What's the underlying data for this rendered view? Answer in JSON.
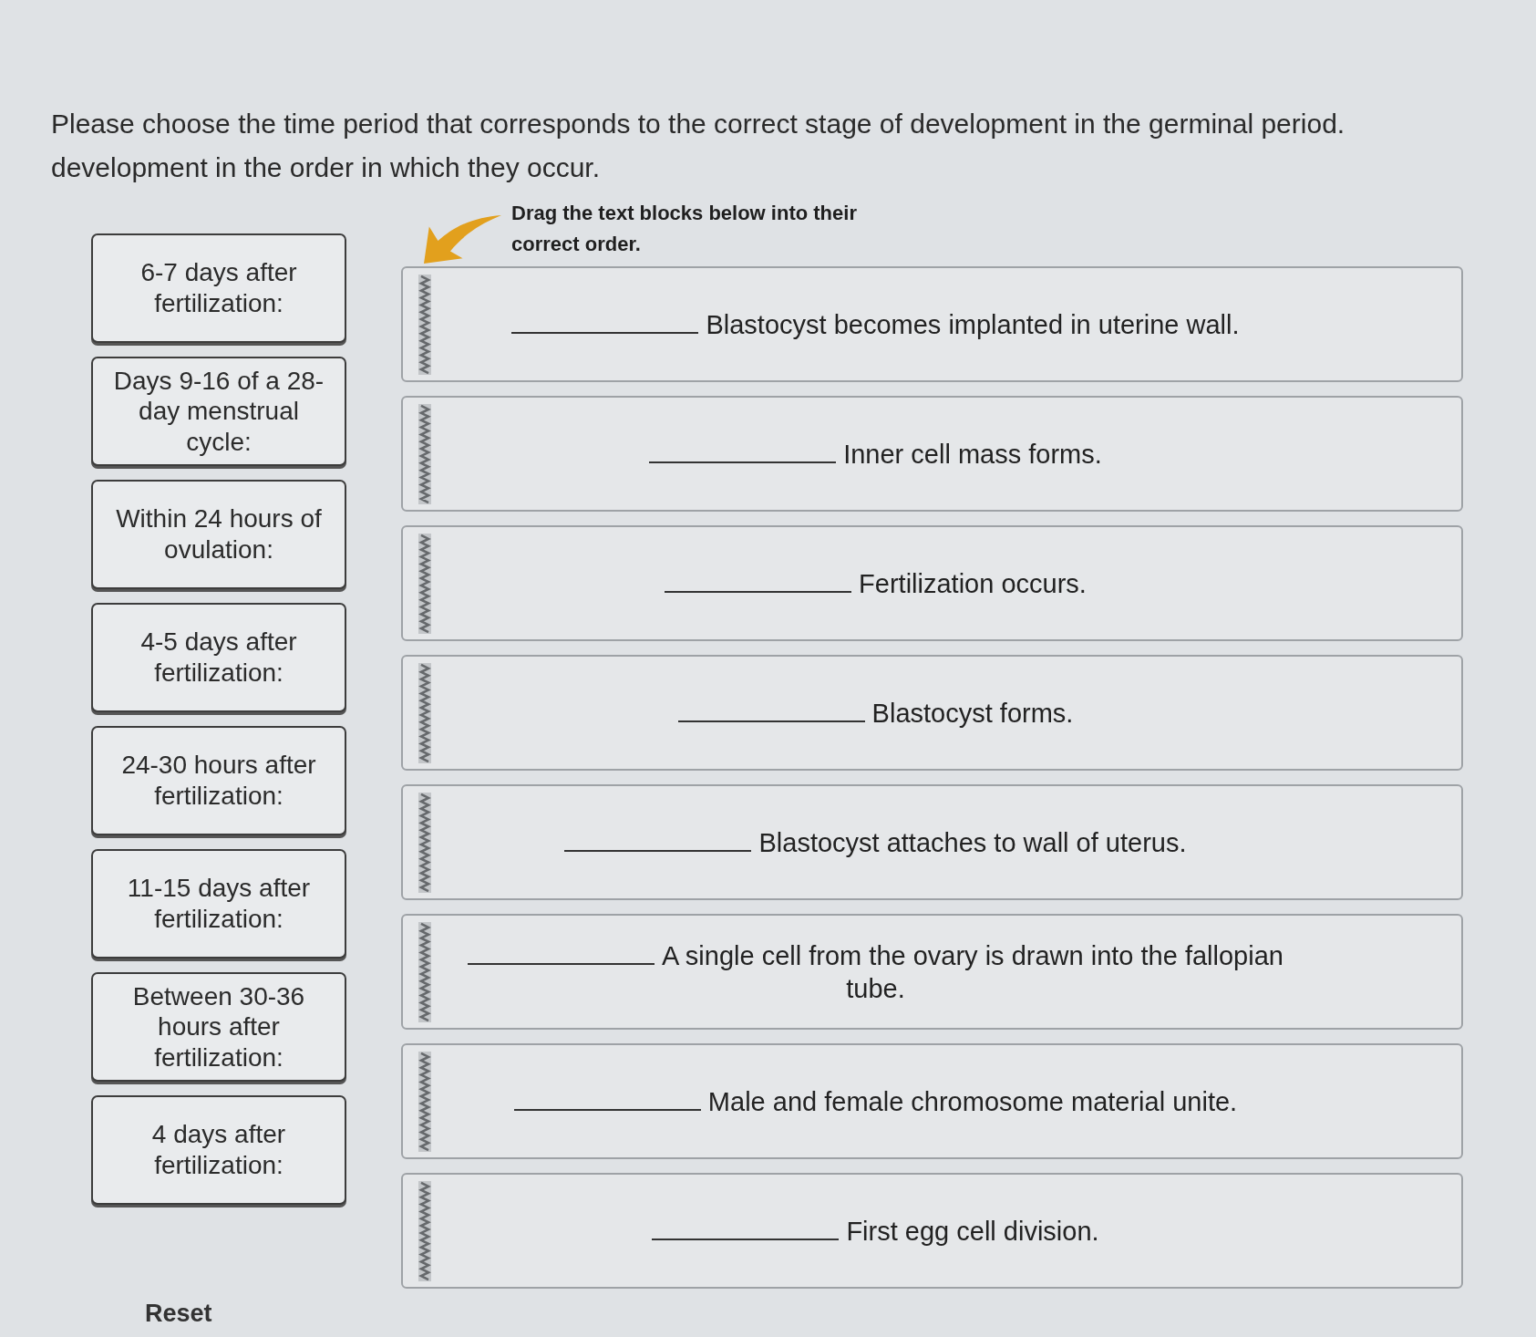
{
  "question": {
    "lines": [
      "Please choose the time period that corresponds to the correct stage of development in the germinal period.",
      "development in the order in which they occur."
    ]
  },
  "instruction": {
    "text": "Drag the text blocks below into their correct order."
  },
  "time_periods": [
    "6-7 days after fertilization:",
    "Days 9-16 of a 28-day menstrual cycle:",
    "Within 24 hours of ovulation:",
    "4-5 days after fertilization:",
    "24-30 hours after fertilization:",
    "11-15 days after fertilization:",
    "Between 30-36 hours after fertilization:",
    "4 days after fertilization:"
  ],
  "statements": [
    "Blastocyst becomes implanted in uterine wall.",
    "Inner cell mass forms.",
    "Fertilization occurs.",
    "Blastocyst forms.",
    "Blastocyst attaches to wall of uterus.",
    "A single cell from the ovary is drawn into the fallopian tube.",
    "Male and female chromosome material unite.",
    "First egg cell division."
  ],
  "reset_button": {
    "label": "Reset"
  }
}
